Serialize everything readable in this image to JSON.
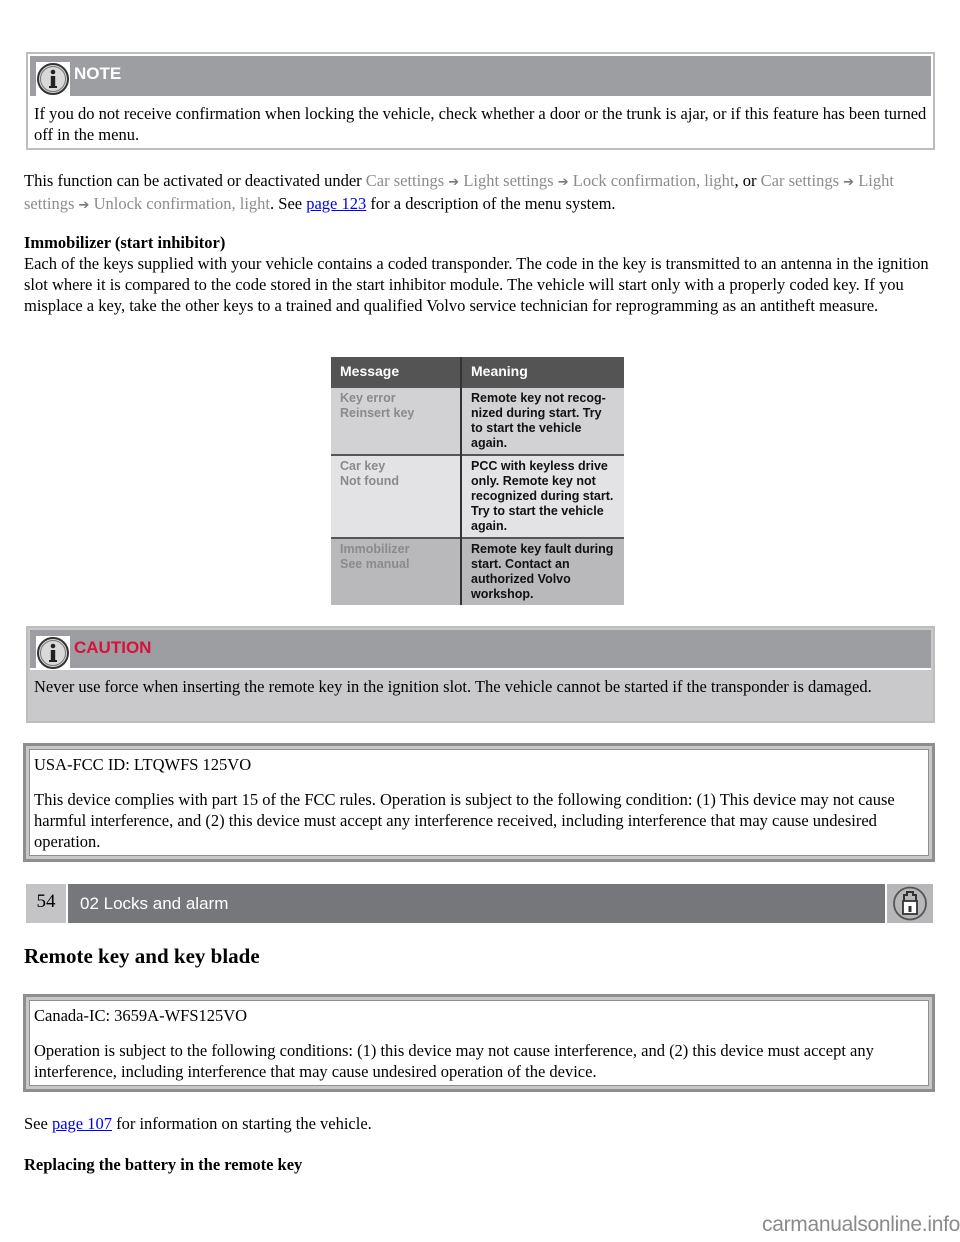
{
  "note": {
    "icon": "info-icon",
    "title": "NOTE",
    "text": "If you do not receive confirmation when locking the vehicle, check whether a door or the trunk is ajar, or if this feature has been turned off in the menu."
  },
  "function_paragraph": {
    "intro": "This function can be activated or deactivated under ",
    "path1": [
      "Car settings",
      "Light settings",
      "Lock confirmation, light"
    ],
    "or": ", or ",
    "path2": [
      "Car settings",
      "Light settings",
      "Unlock confirmation, light"
    ],
    "see": ". See ",
    "link": "page 123",
    "outro": " for a description of the menu system.",
    "arrow_glyph": "➔"
  },
  "immobilizer": {
    "heading": "Immobilizer (start inhibitor)",
    "text": "Each of the keys supplied with your vehicle contains a coded transponder. The code in the key is transmitted to an antenna in the ignition slot where it is compared to the code stored in the start inhibitor module. The vehicle will start only with a properly coded key. If you misplace a key, take the other keys to a trained and qualified Volvo service technician for reprogramming as an antitheft measure."
  },
  "message_table": {
    "headers": [
      "Message",
      "Meaning"
    ],
    "rows": [
      {
        "message": [
          "Key error",
          "Reinsert key"
        ],
        "meaning": "Remote key not recog-nized during start. Try to start the vehicle again."
      },
      {
        "message": [
          "Car key",
          "Not found"
        ],
        "meaning": "PCC with keyless drive only. Remote key not recognized during start. Try to start the vehicle again."
      },
      {
        "message": [
          "Immobilizer",
          "See manual"
        ],
        "meaning": "Remote key fault during start. Contact an authorized Volvo workshop."
      }
    ]
  },
  "caution": {
    "icon": "info-icon",
    "title": "CAUTION",
    "text": "Never use force when inserting the remote key in the ignition slot. The vehicle cannot be started if the transponder is damaged."
  },
  "fcc": {
    "id_line": "USA-FCC ID: LTQWFS 125VO",
    "text": "This device complies with part 15 of the FCC rules. Operation is subject to the following condition: (1) This device may not cause harmful interference, and (2) this device must accept any interference received, including interference that may cause undesired operation."
  },
  "chapter_bar": {
    "page_number": "54",
    "title": "02 Locks and alarm",
    "icon": "padlock-icon"
  },
  "section_heading": "Remote key and key blade",
  "canada": {
    "id_line": "Canada-IC: 3659A-WFS125VO",
    "text": "Operation is subject to the following conditions: (1) this device may not cause interference, and (2) this device must accept any interference, including interference that may cause undesired operation of the device."
  },
  "see_paragraph": {
    "pre": "See ",
    "link": "page 107",
    "post": " for information on starting the vehicle."
  },
  "battery_heading": "Replacing the battery in the remote key",
  "watermark": "carmanualsonline.info",
  "colors": {
    "box_header": "#9c9ea2",
    "caution_title": "#d8103c",
    "chapter_bar": "#76777b",
    "link": "#0000ee",
    "menu_path": "#8c8c8c"
  }
}
